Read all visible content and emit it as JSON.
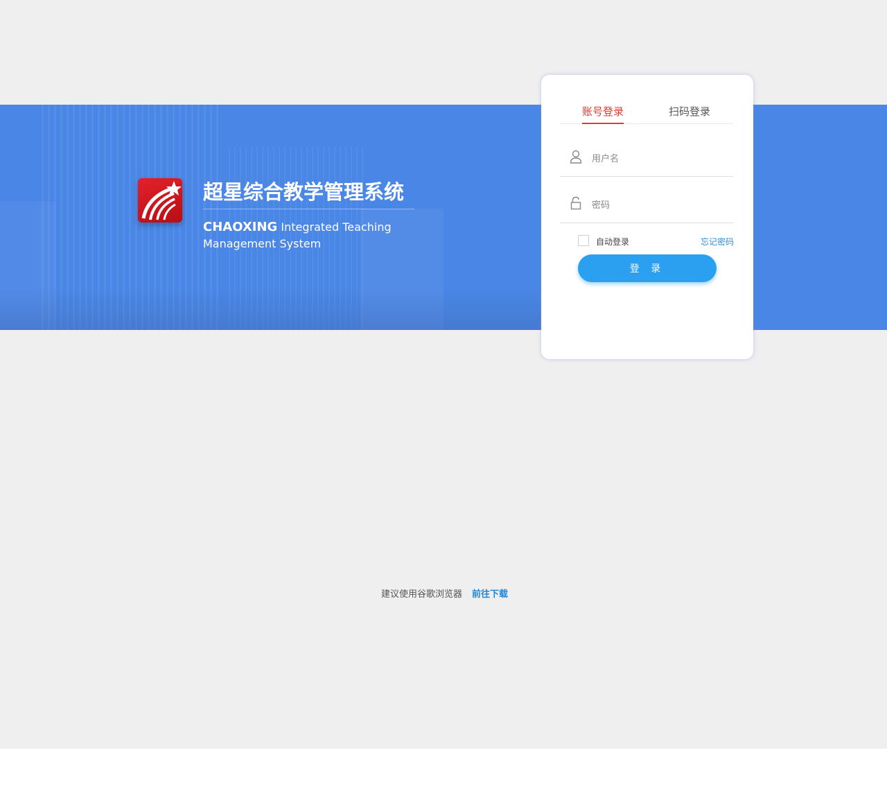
{
  "brand": {
    "title_cn": "超星综合教学管理系统",
    "title_en_brand": "CHAOXING",
    "title_en_rest": " Integrated Teaching Management System",
    "logo_icon": "chaoxing-star-logo"
  },
  "login": {
    "tabs": [
      {
        "label": "账号登录",
        "active": true
      },
      {
        "label": "扫码登录",
        "active": false
      }
    ],
    "username": {
      "placeholder": "用户名",
      "value": "",
      "icon": "user-icon"
    },
    "password": {
      "placeholder": "密码",
      "value": "",
      "icon": "lock-icon"
    },
    "auto_login_label": "自动登录",
    "auto_login_checked": false,
    "forgot_label": "忘记密码",
    "submit_label": "登 录"
  },
  "footer": {
    "tip": "建议使用谷歌浏览器",
    "link": "前往下载"
  },
  "colors": {
    "banner": "#4a86e6",
    "accent_red": "#e13b2f",
    "button_blue": "#2b9ff0",
    "link_blue": "#1f86d8",
    "page_bg": "#efeff0"
  }
}
